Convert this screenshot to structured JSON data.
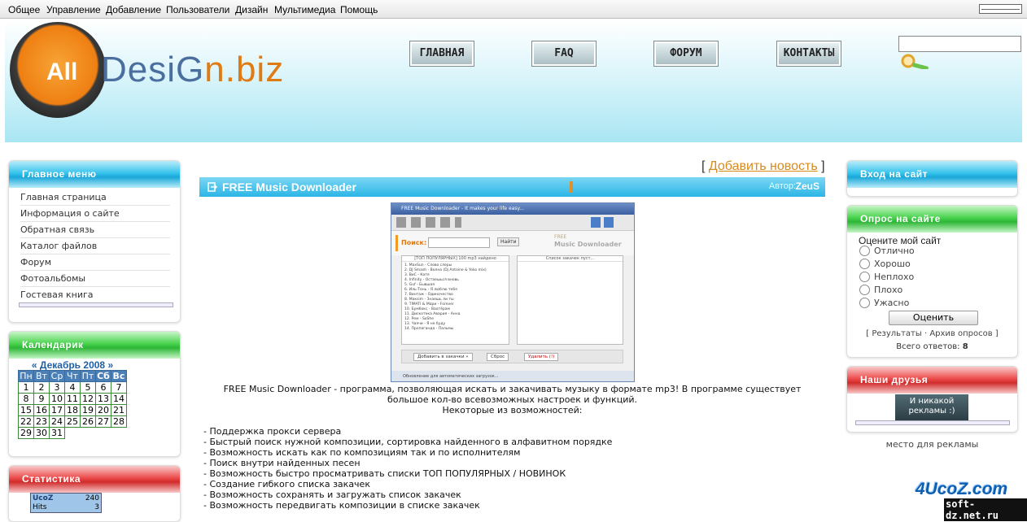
{
  "adminbar": {
    "items": [
      "Общее",
      "Управление",
      "Добавление",
      "Пользователи",
      "Дизайн",
      "Мультимедиа",
      "Помощь"
    ]
  },
  "logo": {
    "badge": "All",
    "name_a": "DesiG",
    "name_b": "n.biz"
  },
  "nav": [
    "ГЛАВНАЯ",
    "FAQ",
    "ФОРУМ",
    "КОНТАКТЫ"
  ],
  "main_menu": {
    "title": "Главное меню",
    "items": [
      "Главная страница",
      "Информация о сайте",
      "Обратная связь",
      "Каталог файлов",
      "Форум",
      "Фотоальбомы",
      "Гостевая книга"
    ]
  },
  "calendar": {
    "title": "Календарик",
    "month": "Декабрь 2008",
    "prev": "«",
    "next": "»",
    "days": [
      "Пн",
      "Вт",
      "Ср",
      "Чт",
      "Пт",
      "Сб",
      "Вс"
    ],
    "weeks": [
      [
        "1",
        "2",
        "3",
        "4",
        "5",
        "6",
        "7"
      ],
      [
        "8",
        "9",
        "10",
        "11",
        "12",
        "13",
        "14"
      ],
      [
        "15",
        "16",
        "17",
        "18",
        "19",
        "20",
        "21"
      ],
      [
        "22",
        "23",
        "24",
        "25",
        "26",
        "27",
        "28"
      ],
      [
        "29",
        "30",
        "31",
        "",
        "",
        "",
        ""
      ]
    ]
  },
  "stats": {
    "title": "Статистика",
    "counter_label": "UcoZ",
    "counter_value": "240",
    "counter_sub": "Hits",
    "counter_sub_value": "3"
  },
  "news": {
    "add_link": "Добавить новость",
    "title": "FREE Music Downloader",
    "author_label": "Автор:",
    "author": "ZeuS",
    "intro1": "FREE Music Downloader - программа, позволяющая искать и закачивать музыку в формате mp3! В программе существует",
    "intro2": "большое кол-во всевозможных настроек и функций.",
    "intro3": "Некоторые из возможностей:",
    "features": [
      "- Поддержка прокси сервера",
      "- Быстрый поиск нужной композиции, сортировка найденного в алфавитном порядке",
      "- Возможность искать как по композициям так и по исполнителям",
      "- Поиск внутри найденных песен",
      "- Возможность быстро просматривать списки ТОП ПОПУЛЯРНЫХ / НОВИНОК",
      "- Создание гибкого списка закачек",
      "- Возможность сохранять и загружать список закачек",
      "- Возможность передвигать композиции в списке закачек"
    ]
  },
  "screenshot": {
    "window_title": "FREE Music Downloader - It makes your life easy...",
    "search_label": "Поиск:",
    "search_btn": "Найти",
    "brand1": "FREE",
    "brand2": "Music Downloader",
    "list_title": "[ТОП ПОПУЛЯРНЫХ] 100 mp3 найдено",
    "queue_title": "Список закачек пуст...",
    "tracks": [
      "1. MaxSun - Слово слеры",
      "2. DJ Smash - Волна (Dj Antoine & Yoko mix)",
      "3. ВиС - Катя",
      "4. Infinity - Остаешься вновь",
      "5. Guf - Бывшая",
      "6. Иль-Тень - Я люблю тебя",
      "7. Винтаж - Одиночество",
      "8. Макsim - Знаешь ли ты",
      "9. TIMATI & Мари - Forever",
      "10. Бумбокс - Вахтёрам",
      "11. Дискотека Авария - Анна",
      "12. Рем - SoShe",
      "13. Чаячи - Я не буду",
      "14. Пропаганда - Пальмы"
    ],
    "btn_add": "Добавить в закачки »",
    "btn_reset": "Сброс",
    "btn_del": "Удалить (!)",
    "status": "Обновление для автоматических загрузок..."
  },
  "login": {
    "title": "Вход на сайт"
  },
  "poll": {
    "title": "Опрос на сайте",
    "question": "Оцените мой сайт",
    "options": [
      "Отлично",
      "Хорошо",
      "Неплохо",
      "Плохо",
      "Ужасно"
    ],
    "vote": "Оценить",
    "results": "Результаты",
    "archive": "Архив опросов",
    "total_label": "Всего ответов:",
    "total": "8"
  },
  "friends": {
    "title": "Наши друзья",
    "banner": "И никакой рекламы :)",
    "ad_text": "место для рекламы"
  },
  "watermark": {
    "line1": "4UcoZ.com",
    "line2": "soft-dz.net.ru"
  },
  "colors": {
    "accent": "#2cb6e6",
    "green": "#2db636",
    "red": "#d12b2b",
    "link": "#d98a1c"
  }
}
